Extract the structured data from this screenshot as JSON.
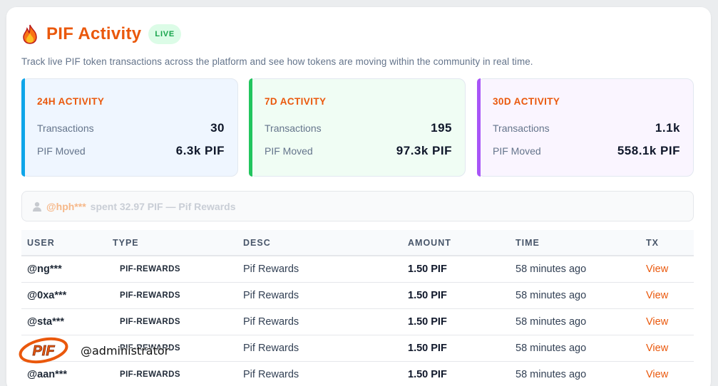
{
  "header": {
    "icon": "fire-icon",
    "title": "PIF Activity",
    "live_badge": "LIVE",
    "subtitle": "Track live PIF token transactions across the platform and see how tokens are moving within the community in real time."
  },
  "stats": [
    {
      "title": "24H ACTIVITY",
      "tx_label": "Transactions",
      "tx_value": "30",
      "moved_label": "PIF Moved",
      "moved_value": "6.3k PIF",
      "accent": "#0ea5e9",
      "bg": "#eff6ff"
    },
    {
      "title": "7D ACTIVITY",
      "tx_label": "Transactions",
      "tx_value": "195",
      "moved_label": "PIF Moved",
      "moved_value": "97.3k PIF",
      "accent": "#22c55e",
      "bg": "#f0fdf4"
    },
    {
      "title": "30D ACTIVITY",
      "tx_label": "Transactions",
      "tx_value": "1.1k",
      "moved_label": "PIF Moved",
      "moved_value": "558.1k PIF",
      "accent": "#a855f7",
      "bg": "#faf5ff"
    }
  ],
  "ticker": {
    "icon": "user-icon",
    "user": "@hph***",
    "text": "spent 32.97 PIF — Pif Rewards"
  },
  "table": {
    "columns": [
      "USER",
      "TYPE",
      "DESC",
      "AMOUNT",
      "TIME",
      "TX"
    ],
    "rows": [
      {
        "user": "@ng***",
        "type": "PIF-REWARDS",
        "desc": "Pif Rewards",
        "amount": "1.50 PIF",
        "time": "58 minutes ago",
        "tx": "View"
      },
      {
        "user": "@0xa***",
        "type": "PIF-REWARDS",
        "desc": "Pif Rewards",
        "amount": "1.50 PIF",
        "time": "58 minutes ago",
        "tx": "View"
      },
      {
        "user": "@sta***",
        "type": "PIF-REWARDS",
        "desc": "Pif Rewards",
        "amount": "1.50 PIF",
        "time": "58 minutes ago",
        "tx": "View"
      },
      {
        "user": "",
        "type": "PIF-REWARDS",
        "desc": "Pif Rewards",
        "amount": "1.50 PIF",
        "time": "58 minutes ago",
        "tx": "View"
      },
      {
        "user": "@aan***",
        "type": "PIF-REWARDS",
        "desc": "Pif Rewards",
        "amount": "1.50 PIF",
        "time": "58 minutes ago",
        "tx": "View"
      }
    ]
  },
  "watermark": {
    "logo_text": "PIF",
    "handle": "@administrator"
  },
  "colors": {
    "accent": "#ea580c",
    "live_bg": "#dcfce7",
    "live_text": "#16a34a"
  }
}
